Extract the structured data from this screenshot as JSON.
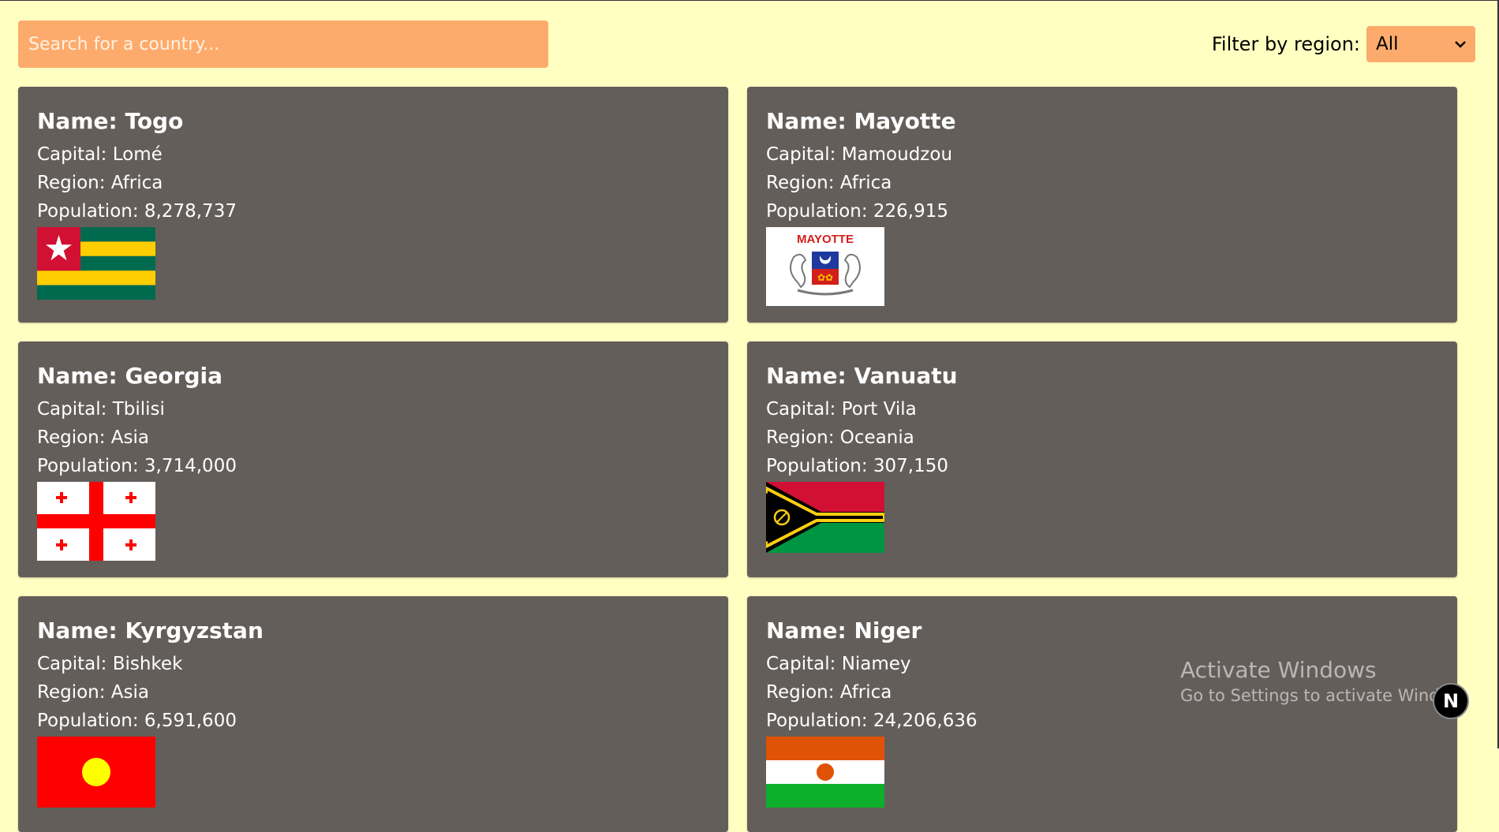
{
  "search": {
    "placeholder": "Search for a country..."
  },
  "filter": {
    "label": "Filter by region:",
    "selected": "All"
  },
  "countries": [
    {
      "name": "Name: Togo",
      "capital": "Capital: Lomé",
      "region": "Region: Africa",
      "population": "Population: 8,278,737",
      "flag": "togo-flag"
    },
    {
      "name": "Name: Mayotte",
      "capital": "Capital: Mamoudzou",
      "region": "Region: Africa",
      "population": "Population: 226,915",
      "flag": "mayotte-flag",
      "flag_text": "MAYOTTE"
    },
    {
      "name": "Name: Georgia",
      "capital": "Capital: Tbilisi",
      "region": "Region: Asia",
      "population": "Population: 3,714,000",
      "flag": "georgia-flag"
    },
    {
      "name": "Name: Vanuatu",
      "capital": "Capital: Port Vila",
      "region": "Region: Oceania",
      "population": "Population: 307,150",
      "flag": "vanuatu-flag"
    },
    {
      "name": "Name: Kyrgyzstan",
      "capital": "Capital: Bishkek",
      "region": "Region: Asia",
      "population": "Population: 6,591,600",
      "flag": "kyrgyzstan-flag"
    },
    {
      "name": "Name: Niger",
      "capital": "Capital: Niamey",
      "region": "Region: Africa",
      "population": "Population: 24,206,636",
      "flag": "niger-flag"
    }
  ],
  "watermark": {
    "title": "Activate Windows",
    "subtitle": "Go to Settings to activate Windows."
  },
  "badge": {
    "letter": "N"
  },
  "colors": {
    "background": "#ffffc2",
    "accent": "#fdab6c",
    "card": "#645e5b"
  }
}
